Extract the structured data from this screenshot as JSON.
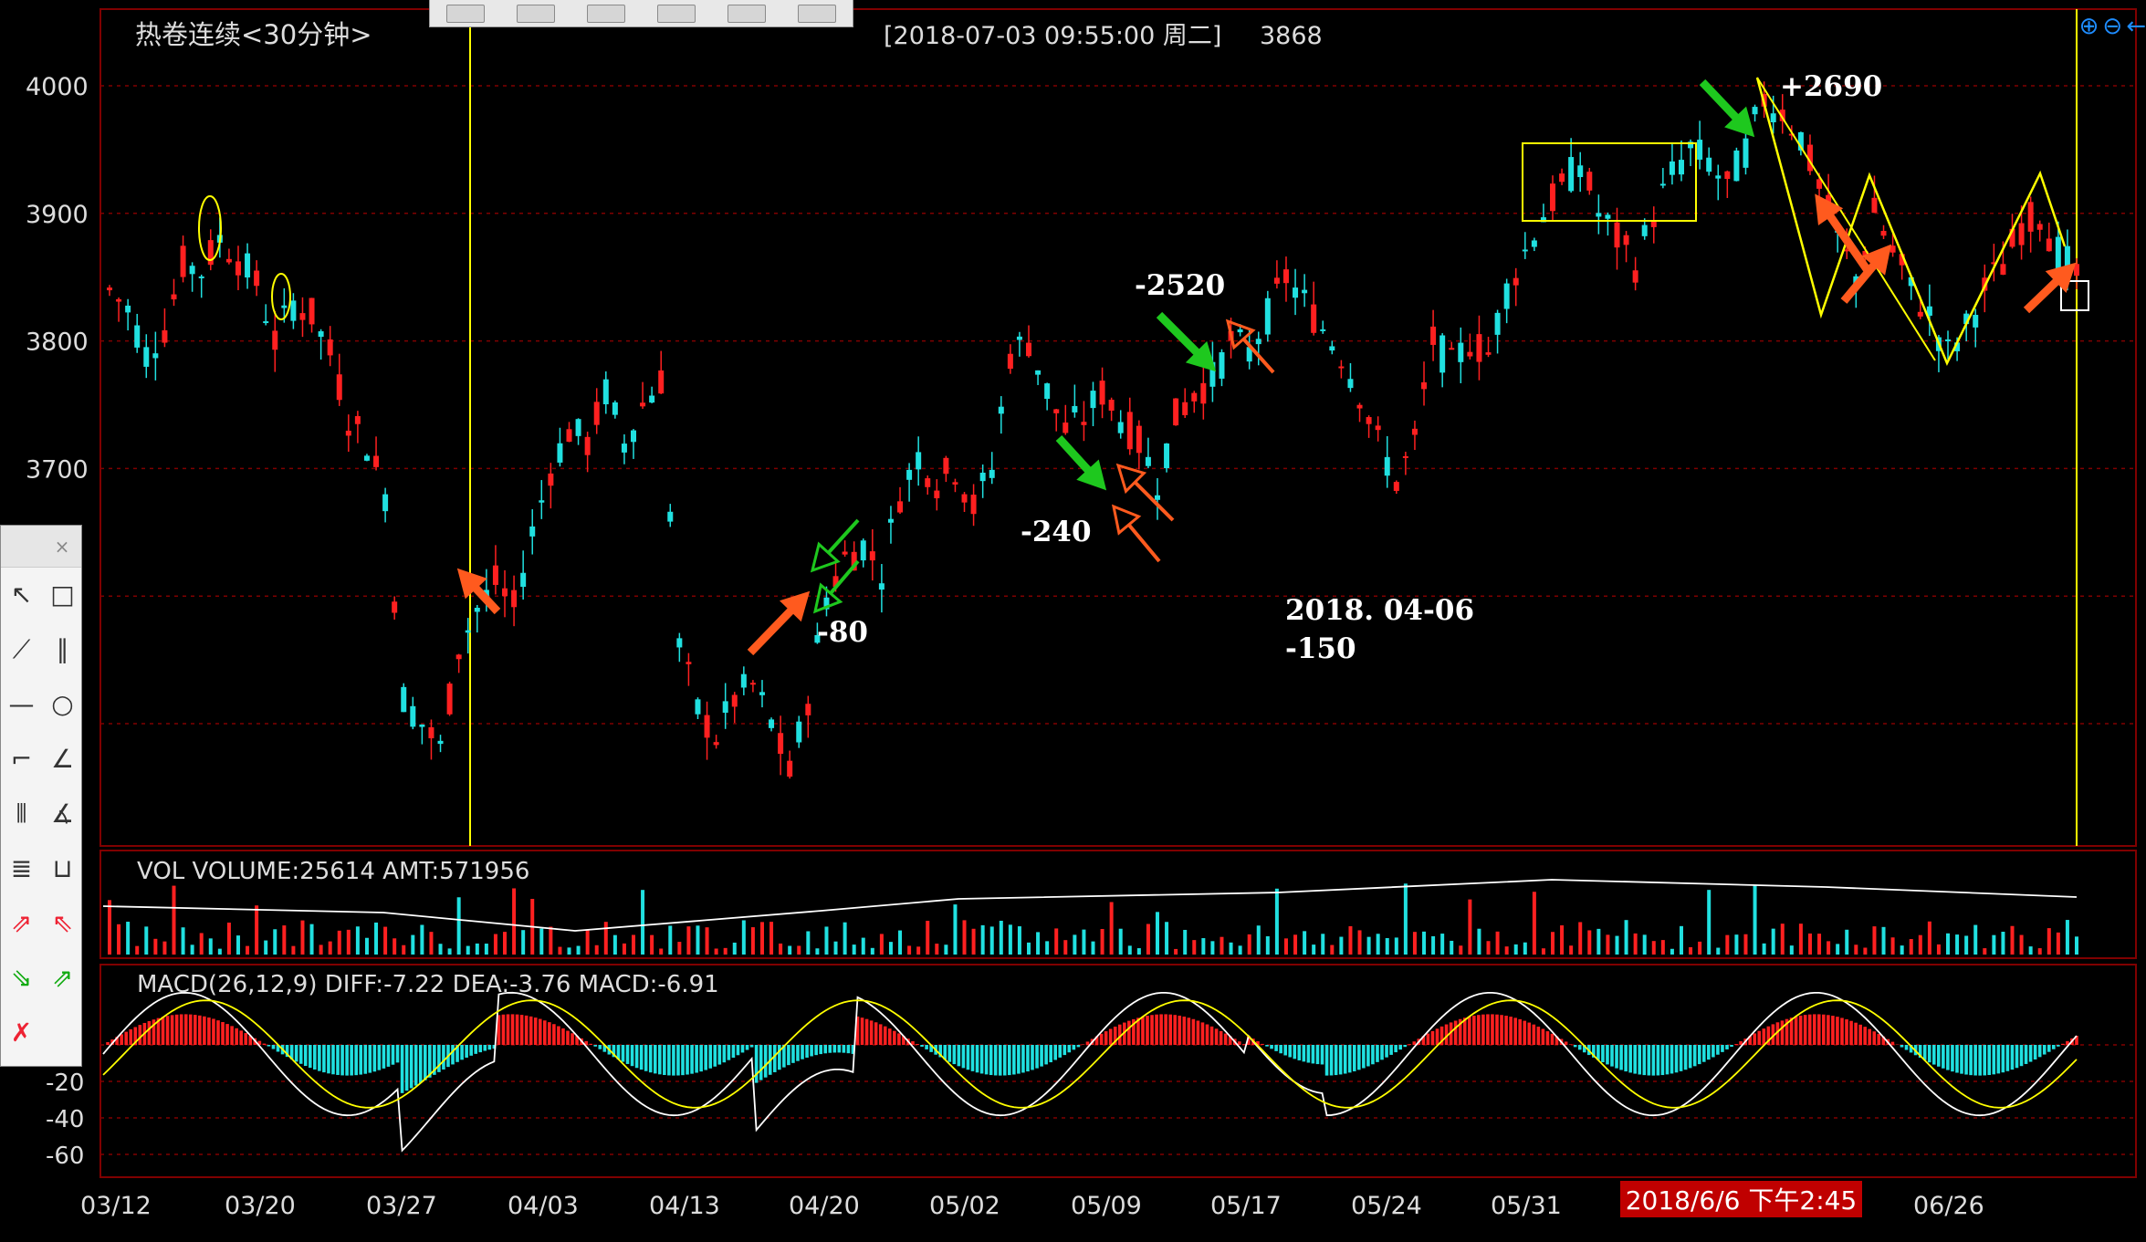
{
  "window": {
    "title": "热卷连续<30分钟>",
    "cursor_info": "[2018-07-03  09:55:00 周二]",
    "cursor_value": "3868"
  },
  "toolbar": {
    "button_count": 6
  },
  "zoom_icons": [
    "zoom-in-icon",
    "zoom-out-icon",
    "arrow-left-icon"
  ],
  "colors": {
    "up": "#ff2020",
    "down": "#20e0e0",
    "grid": "#800000",
    "axis_text": "#dddddd",
    "vline": "#ffff00",
    "annotation": "#ffffff",
    "arrow_orange": "#ff5a1e",
    "arrow_green": "#1ec81e",
    "macd_diff": "#ffffff",
    "macd_dea": "#ffff00",
    "highlight": "#ffff00"
  },
  "chart_data": {
    "type": "candlestick",
    "symbol": "热卷连续",
    "period": "30分钟",
    "price_axis": {
      "ticks": [
        4000,
        3900,
        3800,
        3700
      ]
    },
    "date_ticks": [
      "03/12",
      "03/20",
      "03/27",
      "04/03",
      "04/13",
      "04/20",
      "05/02",
      "05/09",
      "05/17",
      "05/24",
      "05/31",
      "06/26"
    ],
    "price_path": [
      [
        0,
        3840
      ],
      [
        2,
        3825
      ],
      [
        4,
        3790
      ],
      [
        6,
        3810
      ],
      [
        8,
        3860
      ],
      [
        10,
        3855
      ],
      [
        12,
        3880
      ],
      [
        14,
        3865
      ],
      [
        16,
        3845
      ],
      [
        18,
        3800
      ],
      [
        20,
        3830
      ],
      [
        22,
        3820
      ],
      [
        24,
        3790
      ],
      [
        26,
        3740
      ],
      [
        28,
        3720
      ],
      [
        30,
        3680
      ],
      [
        32,
        3520
      ],
      [
        34,
        3500
      ],
      [
        36,
        3480
      ],
      [
        38,
        3560
      ],
      [
        40,
        3590
      ],
      [
        42,
        3610
      ],
      [
        44,
        3590
      ],
      [
        46,
        3650
      ],
      [
        48,
        3700
      ],
      [
        50,
        3730
      ],
      [
        52,
        3720
      ],
      [
        54,
        3760
      ],
      [
        56,
        3720
      ],
      [
        58,
        3750
      ],
      [
        60,
        3770
      ],
      [
        62,
        3560
      ],
      [
        64,
        3510
      ],
      [
        66,
        3490
      ],
      [
        68,
        3520
      ],
      [
        70,
        3530
      ],
      [
        72,
        3500
      ],
      [
        74,
        3460
      ],
      [
        76,
        3520
      ],
      [
        78,
        3600
      ],
      [
        80,
        3630
      ],
      [
        82,
        3640
      ],
      [
        84,
        3620
      ],
      [
        86,
        3680
      ],
      [
        88,
        3710
      ],
      [
        90,
        3690
      ],
      [
        92,
        3700
      ],
      [
        94,
        3670
      ],
      [
        96,
        3700
      ],
      [
        98,
        3790
      ],
      [
        100,
        3800
      ],
      [
        102,
        3760
      ],
      [
        104,
        3730
      ],
      [
        106,
        3740
      ],
      [
        108,
        3760
      ],
      [
        110,
        3740
      ],
      [
        112,
        3720
      ],
      [
        114,
        3690
      ],
      [
        116,
        3740
      ],
      [
        118,
        3760
      ],
      [
        120,
        3770
      ],
      [
        122,
        3800
      ],
      [
        124,
        3790
      ],
      [
        126,
        3820
      ],
      [
        128,
        3850
      ],
      [
        130,
        3830
      ],
      [
        132,
        3810
      ],
      [
        134,
        3790
      ],
      [
        136,
        3760
      ],
      [
        138,
        3720
      ],
      [
        140,
        3690
      ],
      [
        142,
        3720
      ],
      [
        144,
        3800
      ],
      [
        146,
        3780
      ],
      [
        148,
        3800
      ],
      [
        150,
        3790
      ],
      [
        152,
        3840
      ],
      [
        154,
        3870
      ],
      [
        156,
        3900
      ],
      [
        158,
        3920
      ],
      [
        160,
        3940
      ],
      [
        162,
        3900
      ],
      [
        164,
        3880
      ],
      [
        166,
        3860
      ],
      [
        168,
        3900
      ],
      [
        170,
        3930
      ],
      [
        172,
        3950
      ],
      [
        174,
        3940
      ],
      [
        176,
        3920
      ],
      [
        178,
        3950
      ],
      [
        180,
        3990
      ],
      [
        182,
        3980
      ],
      [
        184,
        3960
      ],
      [
        186,
        3920
      ],
      [
        188,
        3880
      ],
      [
        190,
        3850
      ],
      [
        192,
        3900
      ],
      [
        194,
        3870
      ],
      [
        196,
        3840
      ],
      [
        198,
        3820
      ],
      [
        200,
        3790
      ],
      [
        202,
        3810
      ],
      [
        204,
        3840
      ],
      [
        206,
        3860
      ],
      [
        208,
        3890
      ],
      [
        210,
        3900
      ],
      [
        212,
        3870
      ],
      [
        214,
        3850
      ]
    ],
    "volume_header": "VOL  VOLUME:25614 AMT:571956",
    "macd_header": "MACD(26,12,9)  DIFF:-7.22 DEA:-3.76 MACD:-6.91",
    "macd_ticks": [
      -20,
      -40,
      -60
    ],
    "annotations": [
      "+2690",
      "-2520",
      "-240",
      "-80",
      "2018. 04-06",
      "-150"
    ],
    "hover_date_label": "2018/6/6 下午2:45"
  }
}
